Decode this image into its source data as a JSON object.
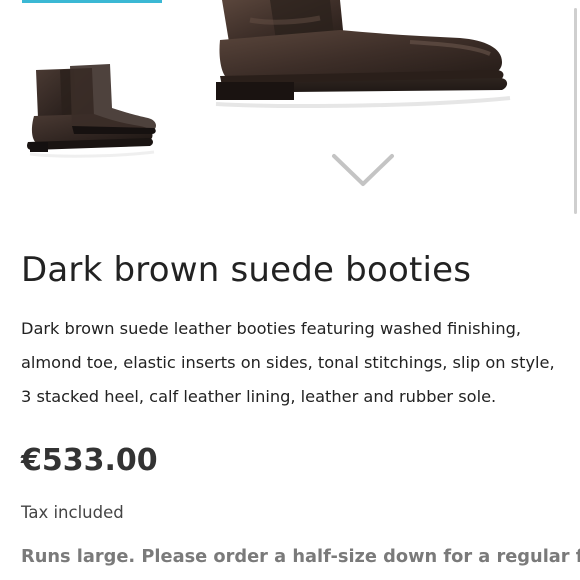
{
  "gallery": {
    "thumbnail_alt": "Dark brown suede bootie thumbnail",
    "main_image_alt": "Dark brown suede bootie",
    "next_icon": "chevron-down-icon",
    "accent_color": "#3bb8d4"
  },
  "product": {
    "title": "Dark brown suede booties",
    "description": "Dark brown suede leather booties featuring washed finishing, almond toe, elastic inserts on sides, tonal stitchings, slip on style, 3 stacked heel, calf leather lining, leather and rubber sole.",
    "price": "€533.00",
    "tax_note": "Tax included",
    "fit_note": "Runs large. Please order a half-size down for a regular fit."
  }
}
